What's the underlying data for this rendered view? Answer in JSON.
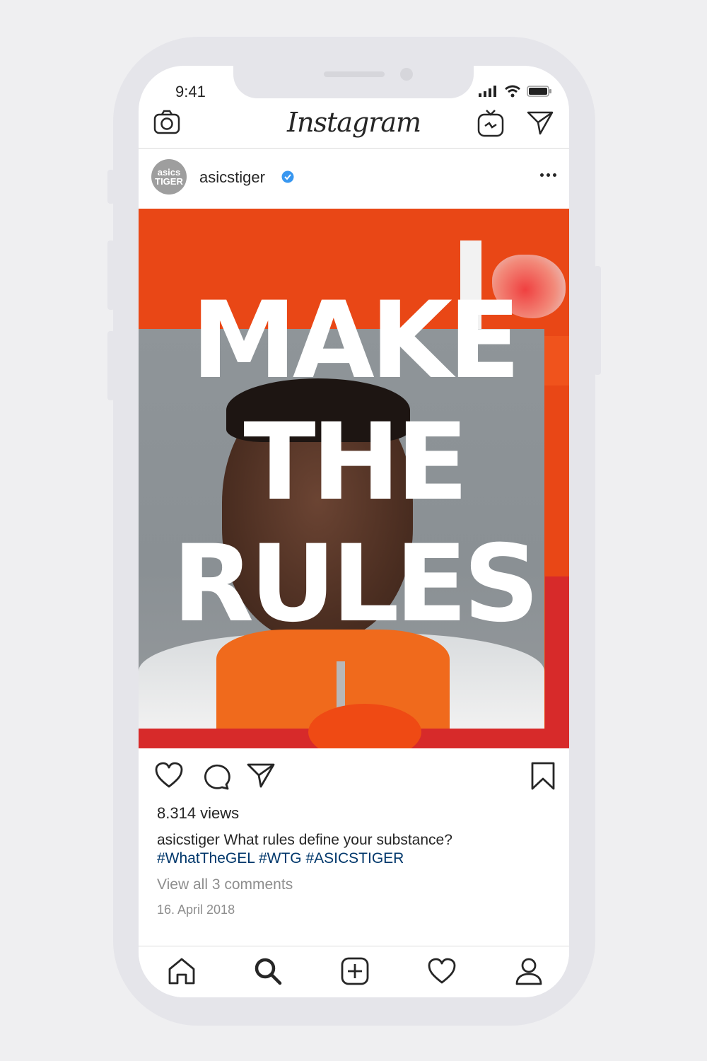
{
  "status_bar": {
    "time": "9:41"
  },
  "header": {
    "app_name": "Instagram"
  },
  "post": {
    "avatar_text_line1": "asics",
    "avatar_text_line2": "TIGER",
    "username": "asicstiger",
    "image_headline": [
      "MAKE",
      "THE",
      "RULES"
    ],
    "views": "8.314 views",
    "caption_user": "asicstiger",
    "caption_text": "What rules define your substance?",
    "caption_tags": "#WhatTheGEL #WTG #ASICSTIGER",
    "view_comments": "View all 3 comments",
    "date": "16. April 2018"
  },
  "icons": {
    "header": [
      "camera-icon",
      "igtv-icon",
      "direct-message-icon"
    ],
    "post_actions": [
      "like-icon",
      "comment-icon",
      "share-icon",
      "bookmark-icon"
    ],
    "tab_bar": [
      "home-icon",
      "search-icon",
      "new-post-icon",
      "activity-icon",
      "profile-icon"
    ]
  },
  "colors": {
    "image_orange": "#e94716",
    "image_red": "#d72a2a",
    "hashtag_blue": "#00376b",
    "verified_blue": "#3897f0",
    "muted_text": "#8e8e8e"
  }
}
